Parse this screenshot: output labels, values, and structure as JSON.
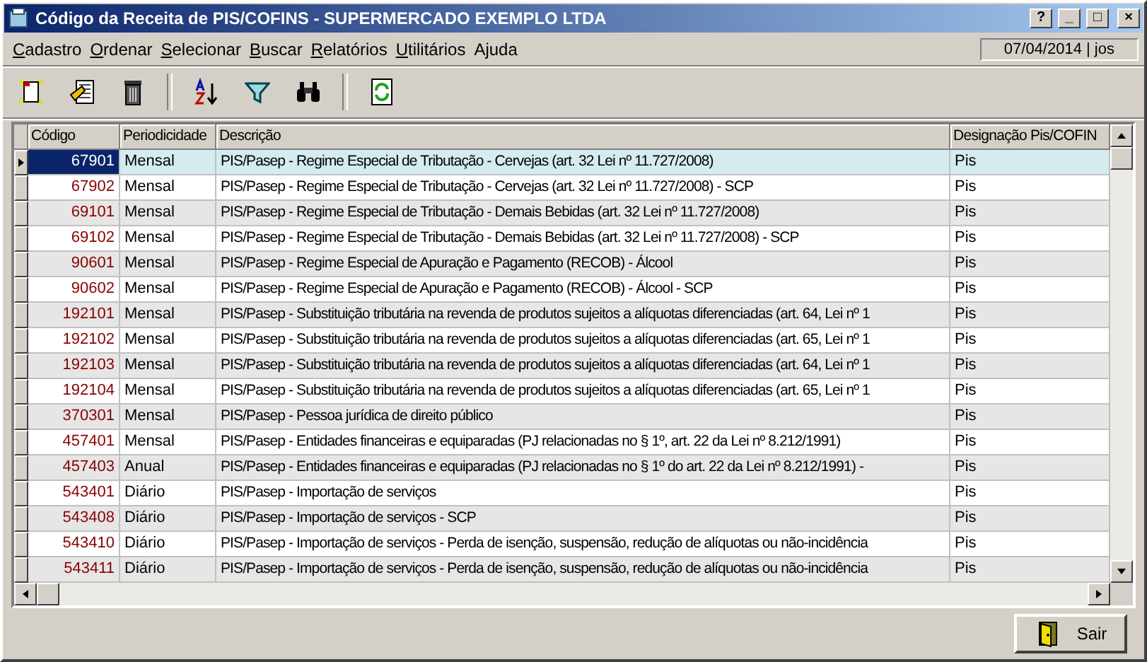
{
  "window": {
    "title": "Código da Receita de PIS/COFINS - SUPERMERCADO EXEMPLO LTDA",
    "controls": [
      "?",
      "_",
      "□",
      "×"
    ]
  },
  "menu": [
    {
      "label": "Cadastro",
      "mnemonic": true
    },
    {
      "label": "Ordenar",
      "mnemonic": true
    },
    {
      "label": "Selecionar",
      "mnemonic": true
    },
    {
      "label": "Buscar",
      "mnemonic": true
    },
    {
      "label": "Relatórios",
      "mnemonic": true
    },
    {
      "label": "Utilitários",
      "mnemonic": true
    },
    {
      "label": "Ajuda",
      "mnemonic": false
    }
  ],
  "status": "07/04/2014 | jos",
  "toolbar": [
    {
      "kind": "new"
    },
    {
      "kind": "edit"
    },
    {
      "kind": "delete"
    },
    {
      "kind": "separator"
    },
    {
      "kind": "sort"
    },
    {
      "kind": "filter"
    },
    {
      "kind": "find"
    },
    {
      "kind": "separator"
    },
    {
      "kind": "refresh"
    }
  ],
  "table": {
    "columns": [
      "Código",
      "Periodicidade",
      "Descrição",
      "Designação Pis/COFIN"
    ],
    "rows": [
      {
        "selected": true,
        "cells": [
          "67901",
          "Mensal",
          "PIS/Pasep - Regime Especial de Tributação - Cervejas (art. 32 Lei nº 11.727/2008)",
          "Pis"
        ]
      },
      {
        "selected": false,
        "cells": [
          "67902",
          "Mensal",
          "PIS/Pasep - Regime Especial de Tributação - Cervejas (art. 32 Lei nº 11.727/2008) - SCP",
          "Pis"
        ]
      },
      {
        "selected": false,
        "cells": [
          "69101",
          "Mensal",
          "PIS/Pasep - Regime Especial de Tributação - Demais Bebidas (art. 32 Lei nº 11.727/2008)",
          "Pis"
        ]
      },
      {
        "selected": false,
        "cells": [
          "69102",
          "Mensal",
          "PIS/Pasep - Regime Especial de Tributação - Demais Bebidas (art. 32 Lei nº 11.727/2008) - SCP",
          "Pis"
        ]
      },
      {
        "selected": false,
        "cells": [
          "90601",
          "Mensal",
          "PIS/Pasep - Regime Especial de Apuração e Pagamento (RECOB) - Álcool",
          "Pis"
        ]
      },
      {
        "selected": false,
        "cells": [
          "90602",
          "Mensal",
          "PIS/Pasep - Regime Especial de Apuração e Pagamento (RECOB) - Álcool - SCP",
          "Pis"
        ]
      },
      {
        "selected": false,
        "cells": [
          "192101",
          "Mensal",
          "PIS/Pasep - Substituição tributária na revenda de produtos sujeitos a alíquotas diferenciadas (art. 64, Lei nº 1",
          "Pis"
        ]
      },
      {
        "selected": false,
        "cells": [
          "192102",
          "Mensal",
          "PIS/Pasep - Substituição tributária na revenda de produtos sujeitos a alíquotas diferenciadas (art. 65, Lei nº 1",
          "Pis"
        ]
      },
      {
        "selected": false,
        "cells": [
          "192103",
          "Mensal",
          "PIS/Pasep - Substituição tributária na revenda de produtos sujeitos a alíquotas diferenciadas (art. 64, Lei nº 1",
          "Pis"
        ]
      },
      {
        "selected": false,
        "cells": [
          "192104",
          "Mensal",
          "PIS/Pasep - Substituição tributária na revenda de produtos sujeitos a alíquotas diferenciadas (art. 65, Lei nº 1",
          "Pis"
        ]
      },
      {
        "selected": false,
        "cells": [
          "370301",
          "Mensal",
          "PIS/Pasep - Pessoa jurídica de direito público",
          "Pis"
        ]
      },
      {
        "selected": false,
        "cells": [
          "457401",
          "Mensal",
          "PIS/Pasep - Entidades financeiras e equiparadas (PJ relacionadas no § 1º, art. 22 da Lei nº 8.212/1991)",
          "Pis"
        ]
      },
      {
        "selected": false,
        "cells": [
          "457403",
          "Anual",
          "PIS/Pasep - Entidades financeiras e equiparadas (PJ relacionadas no § 1º do art. 22 da Lei nº 8.212/1991) -",
          "Pis"
        ]
      },
      {
        "selected": false,
        "cells": [
          "543401",
          "Diário",
          "PIS/Pasep - Importação de serviços",
          "Pis"
        ]
      },
      {
        "selected": false,
        "cells": [
          "543408",
          "Diário",
          "PIS/Pasep - Importação de serviços - SCP",
          "Pis"
        ]
      },
      {
        "selected": false,
        "cells": [
          "543410",
          "Diário",
          "PIS/Pasep - Importação de serviços - Perda de isenção, suspensão, redução de alíquotas ou não-incidência",
          "Pis"
        ]
      },
      {
        "selected": false,
        "cells": [
          "543411",
          "Diário",
          "PIS/Pasep - Importação de serviços - Perda de isenção, suspensão, redução de alíquotas ou não-incidência",
          "Pis"
        ]
      }
    ]
  },
  "buttons": [
    {
      "label": "Sair"
    }
  ]
}
